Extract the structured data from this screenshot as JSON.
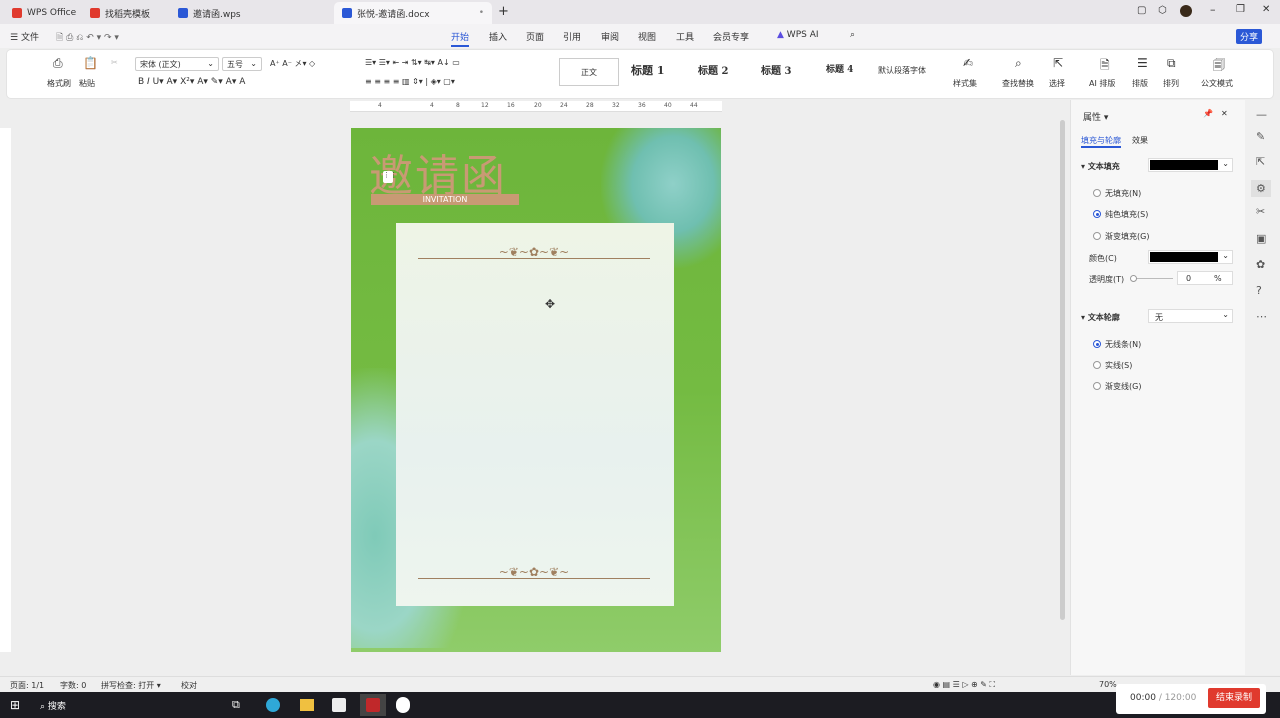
{
  "tabs": [
    {
      "label": "WPS Office",
      "color": "#e03a2e"
    },
    {
      "label": "找稻壳模板",
      "color": "#e03a2e"
    },
    {
      "label": "邀请函.wps",
      "color": "#2b58d6"
    },
    {
      "label": "张悦-邀请函.docx",
      "color": "#2b58d6",
      "active": true
    }
  ],
  "menu": {
    "file": "文件",
    "items": [
      "开始",
      "插入",
      "页面",
      "引用",
      "审阅",
      "视图",
      "工具",
      "会员专享",
      "WPS AI"
    ],
    "share": "分享"
  },
  "ribbon": {
    "format_painter": "格式刷",
    "paste": "粘贴",
    "font": "宋体 (正文)",
    "size": "五号",
    "styles": [
      "正文",
      "标题 1",
      "标题 2",
      "标题 3",
      "标题 4",
      "默认段落字体"
    ],
    "style_set": "样式集",
    "find_replace": "查找替换",
    "select": "选择",
    "ai_layout": "AI 排版",
    "layout": "排版",
    "arrange": "排列",
    "official": "公文模式"
  },
  "ruler": [
    "4",
    "4",
    "8",
    "12",
    "16",
    "20",
    "24",
    "28",
    "32",
    "36",
    "40",
    "44"
  ],
  "document": {
    "title": "邀请函",
    "subtitle": "INVITATION",
    "accent": "#c89a74"
  },
  "panel": {
    "title": "属性",
    "tabs": [
      "填充与轮廓",
      "效果"
    ],
    "fill_section": "文本填充",
    "fill_options": [
      "无填充(N)",
      "纯色填充(S)",
      "渐变填充(G)"
    ],
    "fill_selected": 1,
    "color_label": "颜色(C)",
    "transparency_label": "透明度(T)",
    "transparency_value": "0",
    "percent": "%",
    "outline_section": "文本轮廓",
    "outline_value": "无",
    "outline_options": [
      "无线条(N)",
      "实线(S)",
      "渐变线(G)"
    ],
    "outline_selected": 0,
    "fill_color": "#000000"
  },
  "status": {
    "page": "页面: 1/1",
    "words": "字数: 0",
    "spell": "拼写检查: 打开",
    "proof": "校对",
    "zoom": "70%"
  },
  "taskbar": {
    "search": "搜索"
  },
  "recorder": {
    "elapsed": "00:00",
    "total": "/ 120:00",
    "stop": "结束录制"
  }
}
